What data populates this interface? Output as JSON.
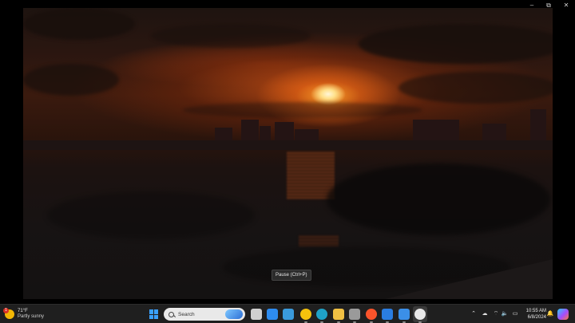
{
  "window": {
    "minimize_glyph": "–",
    "restore_glyph": "⧉",
    "close_glyph": "✕"
  },
  "player": {
    "tooltip": "Pause (Ctrl+P)"
  },
  "taskbar": {
    "weather": {
      "temperature": "71°F",
      "description": "Partly sunny",
      "badge": "1",
      "icon": "sun-cloud-icon"
    },
    "search": {
      "label": "Search"
    },
    "apps": [
      {
        "name": "task-view-icon",
        "color": "#d0d0d0"
      },
      {
        "name": "chart-app-icon",
        "color": "#2d8cf0"
      },
      {
        "name": "notepad-icon",
        "color": "#3a9bdc"
      },
      {
        "name": "chrome-canary-icon",
        "color": "#f4c20d"
      },
      {
        "name": "edge-icon",
        "color": "#1fa2c7"
      },
      {
        "name": "file-explorer-icon",
        "color": "#f0c043"
      },
      {
        "name": "media-player-icon",
        "color": "#9a9a9a"
      },
      {
        "name": "brave-icon",
        "color": "#fb542b"
      },
      {
        "name": "mail-icon",
        "color": "#2a7de1"
      },
      {
        "name": "calendar-icon",
        "color": "#3b8fe8"
      },
      {
        "name": "media-player-active-icon",
        "color": "#e8e8e8"
      }
    ],
    "tray": {
      "overflow_glyph": "⌃",
      "onedrive_glyph": "☁",
      "wifi_glyph": "⌔",
      "volume_glyph": "🔈",
      "battery_glyph": "▭",
      "bell_glyph": "🔔"
    },
    "clock": {
      "time": "10:55 AM",
      "date": "6/8/2024"
    }
  }
}
